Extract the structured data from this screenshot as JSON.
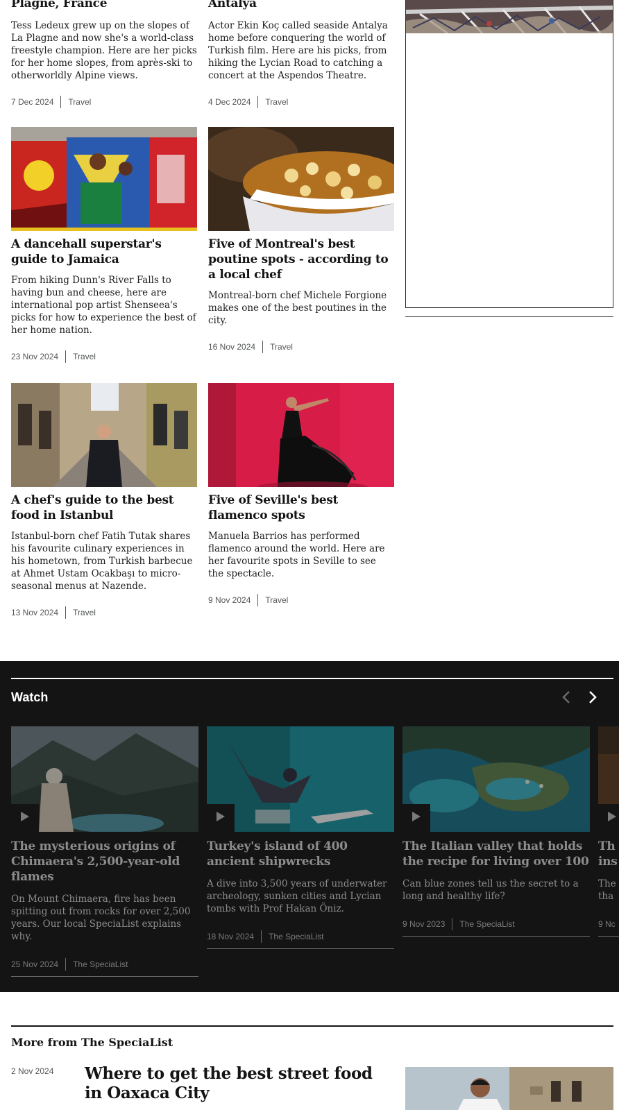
{
  "top_row": [
    {
      "title_tail": "Plagne, France",
      "description": "Tess Ledeux grew up on the slopes of La Plagne and now she's a world-class freestyle champion. Here are her picks for her home slopes, from après-ski to otherworldly Alpine views.",
      "date": "7 Dec 2024",
      "section": "Travel"
    },
    {
      "title_tail": "Antalya",
      "description": "Actor Ekin Koç called seaside Antalya home before conquering the world of Turkish film. Here are his picks, from hiking the Lycian Road to catching a concert at the Aspendos Theatre.",
      "date": "4 Dec 2024",
      "section": "Travel"
    }
  ],
  "articles": [
    {
      "title": "A dancehall superstar's guide to Jamaica",
      "description": "From hiking Dunn's River Falls to having bun and cheese, here are international pop artist Shenseea's picks for how to experience the best of her home nation.",
      "date": "23 Nov 2024",
      "section": "Travel"
    },
    {
      "title": "Five of Montreal's best poutine spots - according to a local chef",
      "description": "Montreal-born chef Michele Forgione makes one of the best poutines in the city.",
      "date": "16 Nov 2024",
      "section": "Travel"
    },
    {
      "title": "A chef's guide to the best food in Istanbul",
      "description": "Istanbul-born chef Fatih Tutak shares his favourite culinary experiences in his hometown, from Turkish barbecue at Ahmet Ustam Ocakbaşı to micro-seasonal menus at Nazende.",
      "date": "13 Nov 2024",
      "section": "Travel"
    },
    {
      "title": "Five of Seville's best flamenco spots",
      "description": "Manuela Barrios has performed flamenco around the world. Here are her favourite spots in Seville to see the spectacle.",
      "date": "9 Nov 2024",
      "section": "Travel"
    }
  ],
  "watch": {
    "heading": "Watch",
    "prev_icon": "chevron-left-icon",
    "next_icon": "chevron-right-icon",
    "cards": [
      {
        "title": "The mysterious origins of Chimaera's 2,500-year-old flames",
        "description": "On Mount Chimaera, fire has been spitting out from rocks for over 2,500 years. Our local SpeciaList explains why.",
        "date": "25 Nov 2024",
        "section": "The SpeciaList"
      },
      {
        "title": "Turkey's island of 400 ancient shipwrecks",
        "description": "A dive into 3,500 years of underwater archeology, sunken cities and Lycian tombs with Prof Hakan Öniz.",
        "date": "18 Nov 2024",
        "section": "The SpeciaList"
      },
      {
        "title": "The Italian valley that holds the recipe for living over 100",
        "description": "Can blue zones tell us the secret to a long and healthy life?",
        "date": "9 Nov 2023",
        "section": "The SpeciaList"
      },
      {
        "title": "Th ins",
        "description": "The tha",
        "date": "9 Nc",
        "section": ""
      }
    ]
  },
  "more": {
    "heading": "More from The SpeciaList",
    "date": "2 Nov 2024",
    "title": "Where to get the best street food in Oaxaca City"
  },
  "colors": {
    "watch_bg": "#141414",
    "text": "#141414",
    "meta": "#545658"
  }
}
